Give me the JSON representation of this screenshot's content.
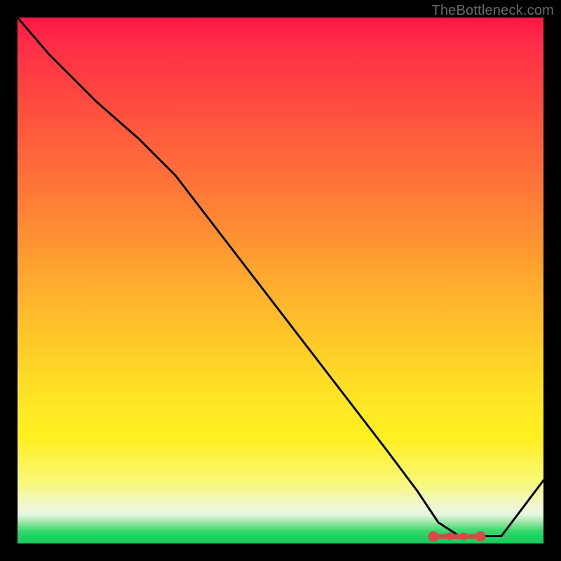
{
  "attribution": "TheBottleneck.com",
  "colors": {
    "curve": "#000000",
    "marker": "#d84a4a"
  },
  "chart_data": {
    "type": "line",
    "title": "",
    "xlabel": "",
    "ylabel": "",
    "xlim": [
      0,
      100
    ],
    "ylim": [
      0,
      100
    ],
    "grid": false,
    "legend": false,
    "series": [
      {
        "name": "bottleneck-curve",
        "x": [
          0,
          6,
          15,
          23,
          30,
          40,
          50,
          60,
          70,
          76,
          80,
          84,
          88,
          92,
          100
        ],
        "y": [
          100,
          93,
          84,
          77,
          70,
          57,
          44,
          31,
          18,
          10,
          4,
          1.4,
          1.4,
          1.4,
          12
        ]
      }
    ],
    "highlight_range": {
      "x_start": 79,
      "x_end": 88,
      "y": 1.4
    }
  }
}
